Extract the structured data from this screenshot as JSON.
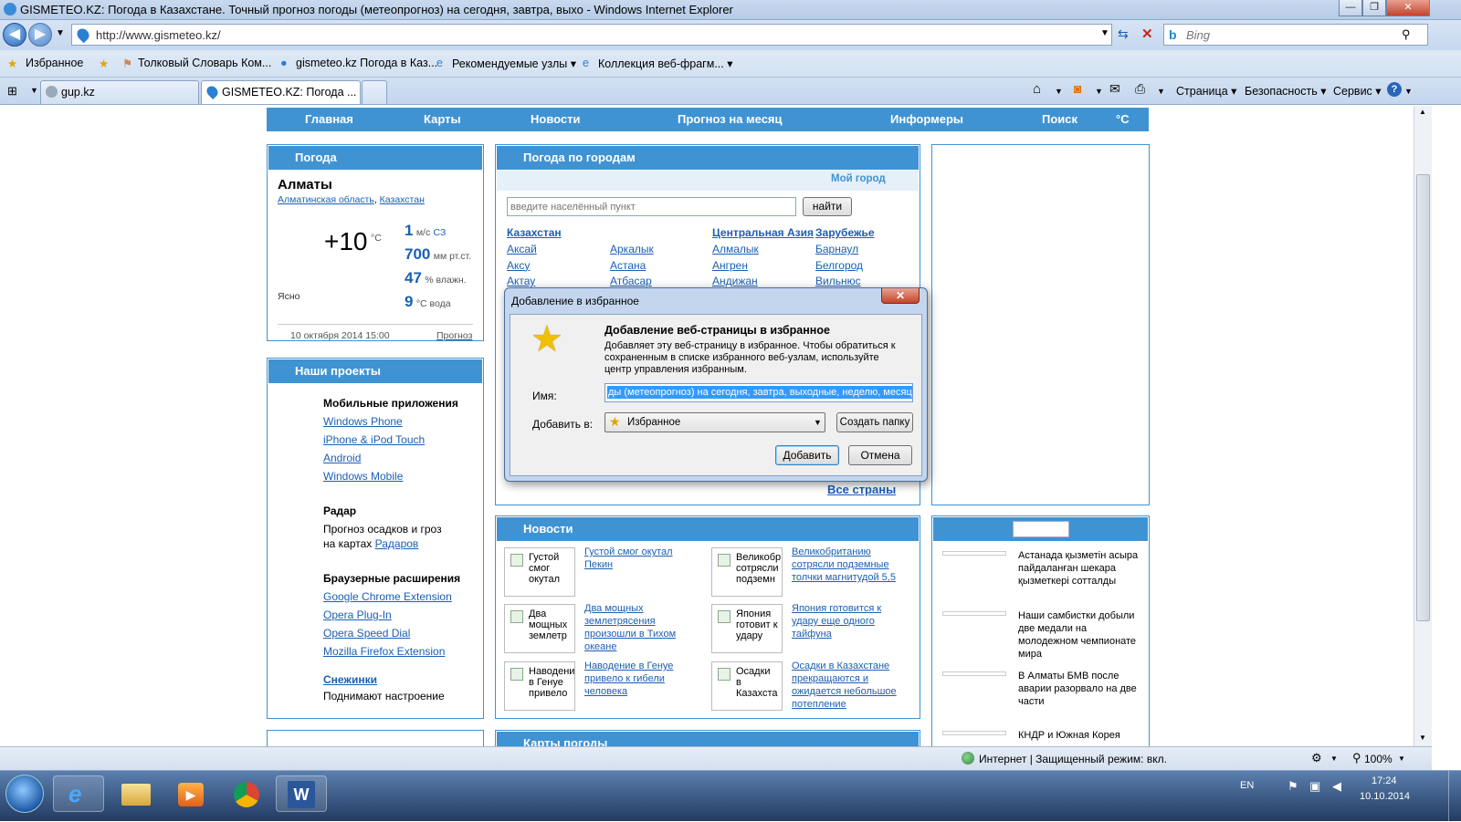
{
  "window": {
    "title": "GISMETEO.KZ: Погода в Казахстане. Точный прогноз погоды (метеопрогноз) на сегодня, завтра, выхо - Windows Internet Explorer",
    "btn_min": "—",
    "btn_max": "❐",
    "btn_close": "✕"
  },
  "address": {
    "url": "http://www.gismeteo.kz/",
    "search_placeholder": "Bing"
  },
  "favorites": {
    "label": "Избранное",
    "items": [
      "Толковый Словарь Ком...",
      "gismeteo.kz Погода в Каз...",
      "Рекомендуемые узлы ▾",
      "Коллекция веб-фрагм... ▾"
    ]
  },
  "tabs": [
    {
      "label": "gup.kz"
    },
    {
      "label": "GISMETEO.KZ: Погода ..."
    }
  ],
  "commands": {
    "page": "Страница ▾",
    "security": "Безопасность ▾",
    "tools": "Сервис ▾"
  },
  "site_nav": [
    "Главная",
    "Карты",
    "Новости",
    "Прогноз на месяц",
    "Информеры",
    "Поиск",
    "°C"
  ],
  "weather": {
    "heading": "Погода",
    "city": "Алматы",
    "region": "Алматинская область",
    "country": "Казахстан",
    "temp": "+10",
    "temp_unit": "°C",
    "condition": "Ясно",
    "wind_value": "1",
    "wind_unit": "м/с",
    "wind_dir": "СЗ",
    "pressure_value": "700",
    "pressure_unit": "мм рт.ст.",
    "humidity_value": "47",
    "humidity_unit": "% влажн.",
    "water_value": "9",
    "water_unit": "°С вода",
    "date": "10 октября 2014 15:00",
    "forecast_link": "Прогноз"
  },
  "projects": {
    "heading": "Наши проекты",
    "mobile_title": "Мобильные приложения",
    "mobile_links": [
      "Windows Phone",
      "iPhone & iPod Touch",
      "Android",
      "Windows Mobile"
    ],
    "radar_title": "Радар",
    "radar_text1": "Прогноз осадков и гроз",
    "radar_text2": "на картах",
    "radar_link": "Радаров",
    "ext_title": "Браузерные расширения",
    "ext_links": [
      "Google Chrome Extension",
      "Opera Plug-In",
      "Opera Speed Dial",
      "Mozilla Firefox Extension"
    ],
    "snow_link": "Снежинки",
    "snow_text": "Поднимают настроение"
  },
  "cities": {
    "heading": "Погода по городам",
    "my_city": "Мой город",
    "search_placeholder": "введите населённый пункт",
    "find_button": "найти",
    "col1_title": "Казахстан",
    "col1": [
      "Аксай",
      "Аксу",
      "Актау"
    ],
    "col2": [
      "Аркалык",
      "Астана",
      "Атбасар"
    ],
    "col3_title": "Центральная Азия",
    "col3": [
      "Алмалык",
      "Ангрен",
      "Андижан"
    ],
    "col4_title": "Зарубежье",
    "col4": [
      "Барнаул",
      "Белгород",
      "Вильнюс"
    ],
    "all_countries": "Все страны"
  },
  "news": {
    "heading": "Новости",
    "items": [
      {
        "thumb": "Густой смог окутал",
        "title": "Густой смог окутал Пекин"
      },
      {
        "thumb": "Великобр сотрясли подземн",
        "title": "Великобританию сотрясли подземные толчки магнитудой 5,5"
      },
      {
        "thumb": "Два мощных землетр",
        "title": "Два мощных землетрясения произошли в Тихом океане"
      },
      {
        "thumb": "Япония готовит к удару",
        "title": "Япония готовится к удару еще одного тайфуна"
      },
      {
        "thumb": "Наводени в Генуе привело",
        "title": "Наводение в Генуе привело к гибели человека"
      },
      {
        "thumb": "Осадки в Казахста",
        "title": "Осадки в Казахстане прекращаются и ожидается небольшое потепление"
      }
    ]
  },
  "side_news": [
    "Астанада қызметін асыра пайдаланған шекара қызметкері сотталды",
    "Наши самбистки добыли две медали на молодежном чемпионате мира",
    "В Алматы БМВ после аварии разорвало на две части",
    "КНДР и Южная Корея"
  ],
  "maps": {
    "heading": "Карты погоды"
  },
  "dialog": {
    "title": "Добавление в избранное",
    "close": "✕",
    "heading": "Добавление веб-страницы в избранное",
    "description": "Добавляет эту веб-страницу в избранное. Чтобы обратиться к сохраненным в списке избранного веб-узлам, используйте центр управления избранным.",
    "name_label": "Имя:",
    "name_value": "ды (метеопрогноз) на сегодня, завтра, выходные, неделю, месяц.",
    "add_to_label": "Добавить в:",
    "folder_value": "Избранное",
    "new_folder_button": "Создать папку",
    "add_button": "Добавить",
    "cancel_button": "Отмена"
  },
  "status": {
    "zone": "Интернет | Защищенный режим: вкл.",
    "zoom": "100%"
  },
  "taskbar": {
    "lang": "EN",
    "time": "17:24",
    "date": "10.10.2014"
  },
  "colors": {
    "site_blue": "#3f93d3",
    "link": "#1a5fb4"
  }
}
